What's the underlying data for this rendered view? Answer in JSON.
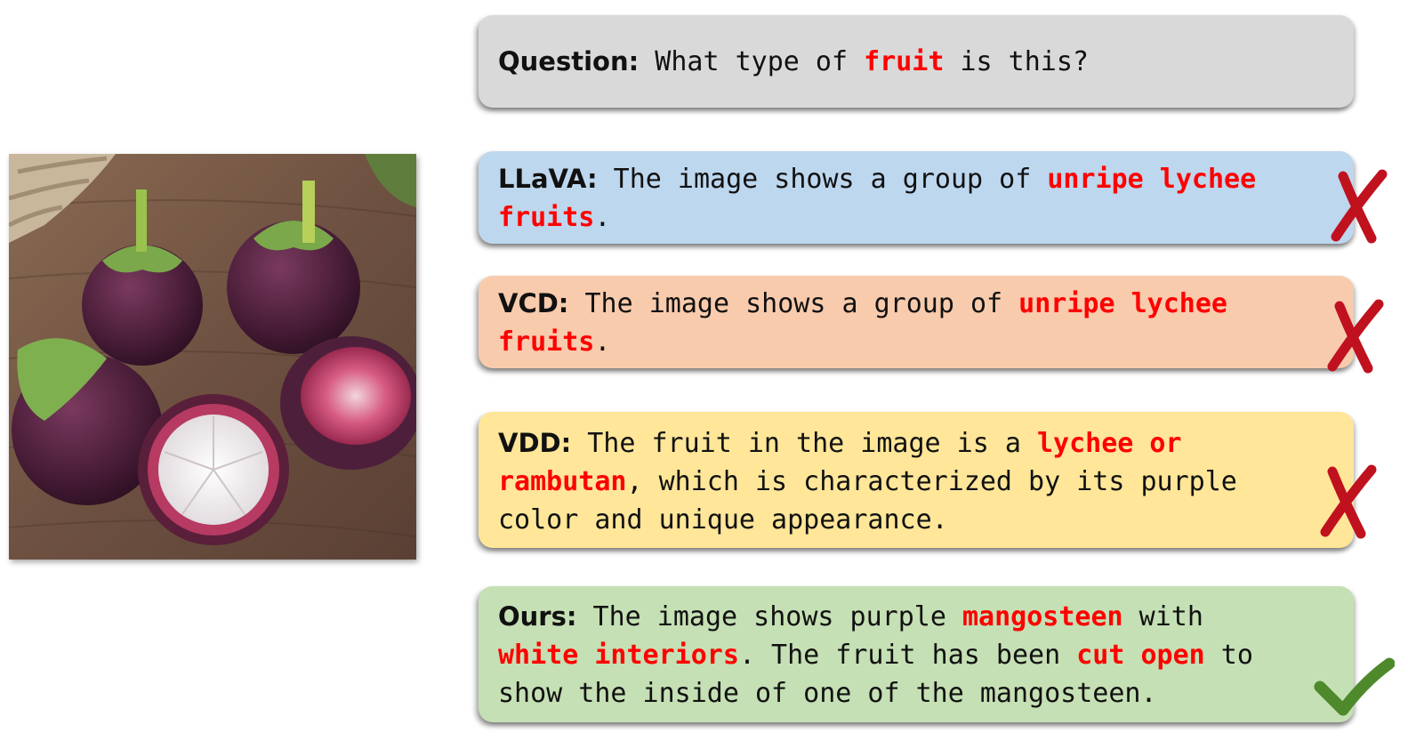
{
  "question": {
    "label": "Question:",
    "t1": " What type of ",
    "h1": "fruit",
    "t2": " is this?"
  },
  "llava": {
    "label": "LLaVA:",
    "t1": " The image shows a group of ",
    "h1": "unripe lychee",
    "h2": "fruits",
    "t2": "."
  },
  "vcd": {
    "label": "VCD:",
    "t1": " The image shows a group of ",
    "h1": "unripe lychee",
    "h2": "fruits",
    "t2": "."
  },
  "vdd": {
    "label": "VDD:",
    "t1": " The fruit in the image is a ",
    "h1": "lychee or",
    "h2": "rambutan",
    "t2": ", which is characterized by its purple",
    "t3": "color and unique appearance."
  },
  "ours": {
    "label": "Ours:",
    "t1": " The image shows purple ",
    "h1": "mangosteen",
    "t2": " with",
    "h2": "white interiors",
    "t3": ". The fruit has been ",
    "h3": "cut open",
    "t4": " to",
    "t5": "show the inside of one of the mangosteen."
  },
  "colors": {
    "highlight": "#ff0000",
    "wrong": "#c0111f",
    "correct": "#4e8a2c"
  },
  "icons": {
    "wrong": "cross-mark-icon",
    "correct": "check-mark-icon",
    "photo": "mangosteen-fruit-photo"
  }
}
